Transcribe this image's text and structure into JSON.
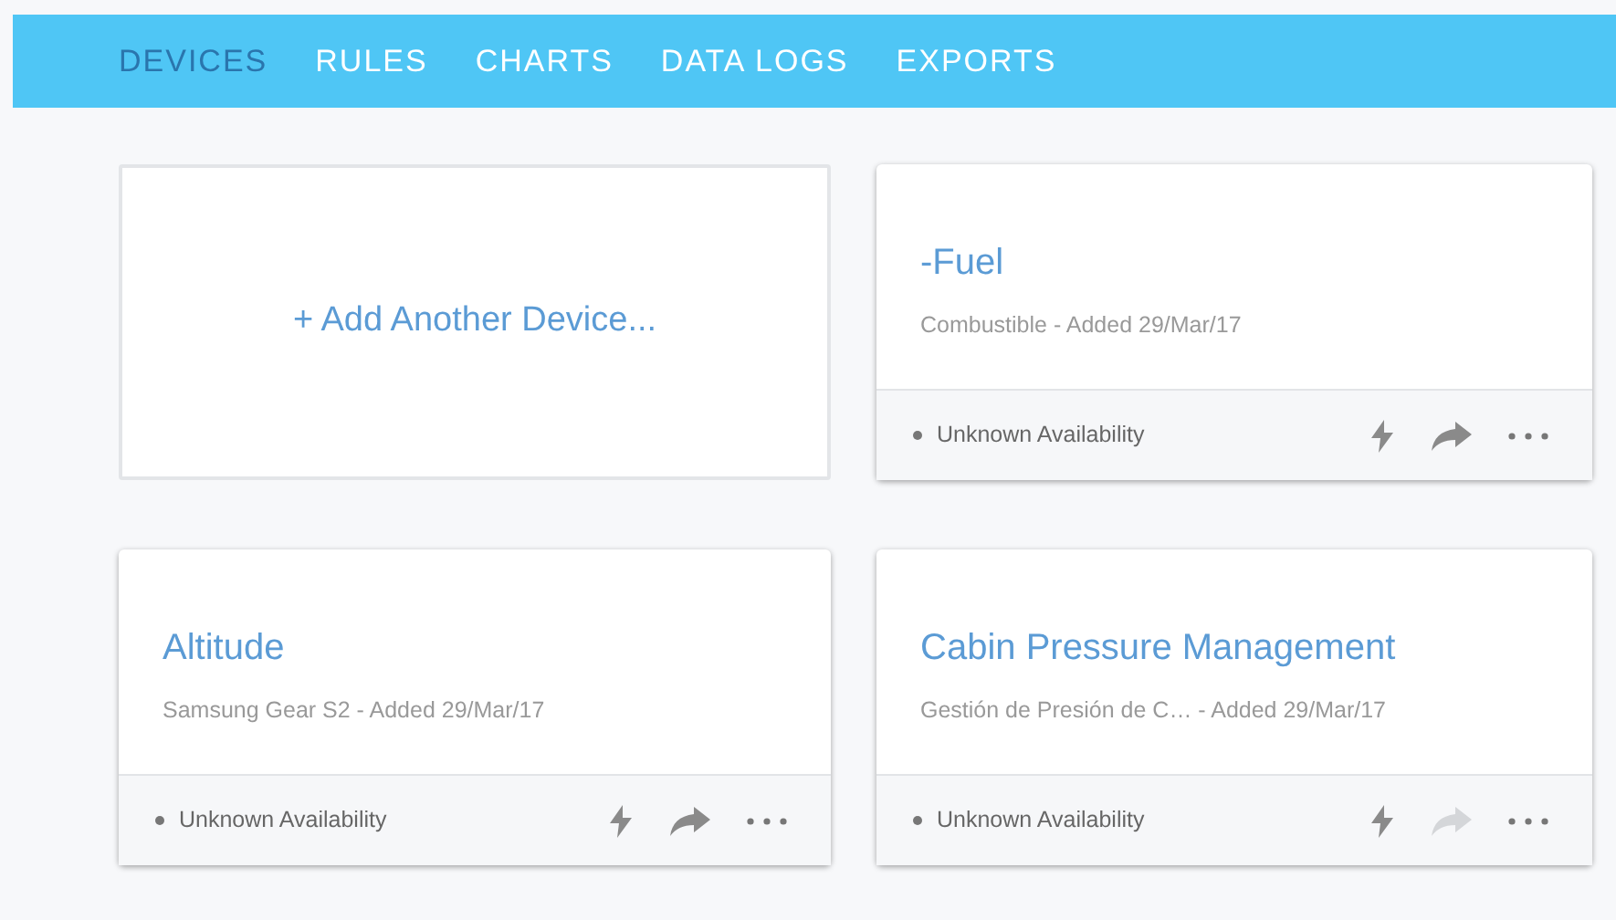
{
  "nav": [
    {
      "label": "DEVICES",
      "selected": true
    },
    {
      "label": "RULES",
      "selected": false
    },
    {
      "label": "CHARTS",
      "selected": false
    },
    {
      "label": "DATA LOGS",
      "selected": false
    },
    {
      "label": "EXPORTS",
      "selected": false
    }
  ],
  "cards": [
    {
      "kind": "add",
      "label": "+ Add Another Device..."
    },
    {
      "kind": "device",
      "title": "-Fuel",
      "subtitle": "Combustible - Added 29/Mar/17",
      "status": "Unknown Availability",
      "share_disabled": false
    },
    {
      "kind": "device",
      "title": "Altitude",
      "subtitle": "Samsung Gear S2 - Added 29/Mar/17",
      "status": "Unknown Availability",
      "share_disabled": false
    },
    {
      "kind": "device",
      "title": "Cabin Pressure Management",
      "subtitle": "Gestión de Presión de C… - Added 29/Mar/17",
      "status": "Unknown Availability",
      "share_disabled": true
    }
  ]
}
